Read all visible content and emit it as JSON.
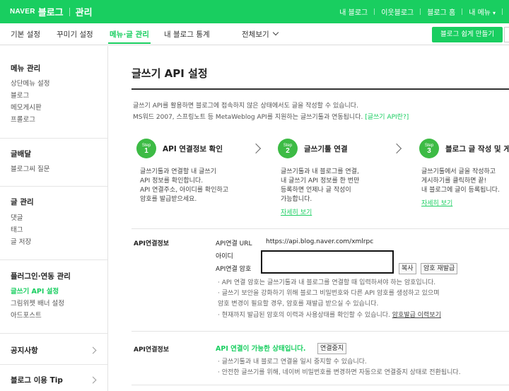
{
  "topbar": {
    "brand_naver": "NAVER",
    "brand_blog": "블로그",
    "brand_admin": "관리",
    "links": [
      "내 블로그",
      "이웃블로그",
      "블로그 홈",
      "내 메뉴"
    ],
    "menu_caret": "▾"
  },
  "tabs": {
    "items": [
      "기본 설정",
      "꾸미기 설정",
      "메뉴·글 관리",
      "내 블로그 통계"
    ],
    "all_view": "전체보기",
    "easy_button": "블로그 쉽게 만들기"
  },
  "sidebar": {
    "menu_admin": "메뉴 관리",
    "menu_admin_items": [
      "상단메뉴 설정",
      "블로그",
      "메모게시판",
      "프롤로그"
    ],
    "distribution": "글배달",
    "distribution_items": [
      "블로그씨 질문"
    ],
    "post_admin": "글 관리",
    "post_admin_items": [
      "댓글",
      "태그",
      "글 저장"
    ],
    "plugin": "플러그인·연동 관리",
    "plugin_items": [
      "글쓰기 API 설정",
      "그림위젯 배너 설정",
      "아드포스트"
    ],
    "notice": "공지사항",
    "tip": "블로그 이용 Tip"
  },
  "main": {
    "title": "글쓰기 API 설정",
    "desc1": "글쓰기 API를 활용하면 블로그에 접속하지 않은 상태에서도 글을 작성할 수 있습니다.",
    "desc2": "MS워드 2007, 스프링노트 등 MetaWeblog API를 지원하는 글쓰기툴과 연동됩니다.",
    "desc_link": "[글쓰기 API란?]",
    "steps": [
      {
        "badge_top": "Step",
        "badge_num": "1",
        "title": "API 연결정보 확인",
        "lines": [
          "글쓰기툴과 연결할 내 글쓰기",
          "API 정보를 확인합니다.",
          "API 연결주소, 아이디를 확인하고",
          "암호를 발급받으세요."
        ]
      },
      {
        "badge_top": "Step",
        "badge_num": "2",
        "title": "글쓰기툴 연결",
        "lines": [
          "글쓰기툴과 내 블로그를 연결,",
          "내 글쓰기 API 정보를 한 번만",
          "등록하면 언제나 글 작성이",
          "가능합니다."
        ],
        "link": "자세히 보기"
      },
      {
        "badge_top": "Step",
        "badge_num": "3",
        "title": "블로그 글 작성 및 게시",
        "lines": [
          "글쓰기툴에서 글을 작성하고",
          "게시하기를 클릭하면 끝!",
          "내 블로그에 글이 등록됩니다."
        ],
        "link": "자세히 보기"
      }
    ],
    "info": {
      "label": "API연결정보",
      "url_label": "API연결 URL",
      "url_value": "https://api.blog.naver.com/xmlrpc",
      "id_label": "아이디",
      "pw_label": "API연결 암호",
      "copy_btn": "복사",
      "reissue_btn": "암호 재발급",
      "notes": [
        "· API 연결 암호는 글쓰기툴과 내 블로그를 연결할 때 입력하셔야 하는 암호입니다.",
        "· 글쓰기 보안을 강화하기 위해 블로그 비밀번호와 다른 API 암호를 생성하고 있으며",
        "  암호 변경이 필요할 경우, 암호를 재발급 받으실 수 있습니다.",
        "· 현재까지 발급된 암호의 이력과 사용상태를 확인할 수 있습니다."
      ],
      "history_link": "암호발급 이력보기"
    },
    "status": {
      "label": "API연결정보",
      "text": "API 연결이 가능한 상태입니다.",
      "stop_btn": "연결중지",
      "notes": [
        "· 글쓰기툴과 내 블로그 연결을 일시 중지할 수 있습니다.",
        "· 안전한 글쓰기를 위해, 네이버 비밀번호를 변경하면 자동으로 연결중지 상태로 전환됩니다."
      ]
    }
  }
}
